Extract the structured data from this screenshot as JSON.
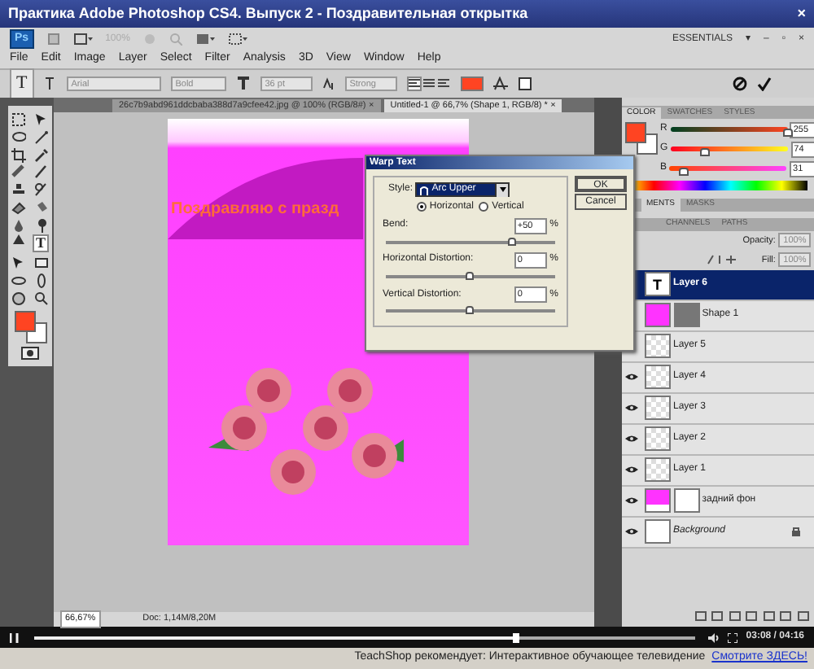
{
  "window": {
    "title": "Практика Adobe Photoshop CS4. Выпуск 2 - Поздравительная открытка",
    "close": "×"
  },
  "app_bar": {
    "logo": "Ps",
    "zoom": "100%",
    "workspace": "ESSENTIALS",
    "workspace_caret": "▾",
    "controls": [
      "–",
      "▫",
      "×"
    ]
  },
  "menu": [
    "File",
    "Edit",
    "Image",
    "Layer",
    "Select",
    "Filter",
    "Analysis",
    "3D",
    "View",
    "Window",
    "Help"
  ],
  "options_bar": {
    "tool": "T",
    "font_family": "Arial",
    "font_style": "Bold",
    "font_size": "36 pt",
    "antialias": "Strong",
    "alignment": [
      {
        "selected": true
      },
      {
        "selected": false
      },
      {
        "selected": false
      }
    ]
  },
  "documents": [
    {
      "title": "26c7b9abd961ddcbaba388d7a9cfee42.jpg @ 100% (RGB/8#)",
      "close": "×",
      "selected": false
    },
    {
      "title": "Untitled-1 @ 66,7% (Shape 1, RGB/8) *",
      "close": "×",
      "selected": true
    }
  ],
  "toolbox": {
    "type_tool": "T"
  },
  "canvas": {
    "text": "Поздравляю с празд"
  },
  "status_bar": {
    "zoom": "66,67%",
    "doc": "Doc: 1,14M/8,20M"
  },
  "color_panel": {
    "tabs": [
      {
        "label": "COLOR",
        "selected": true
      },
      {
        "label": "SWATCHES",
        "selected": false
      },
      {
        "label": "STYLES",
        "selected": false
      }
    ],
    "channels": [
      {
        "name": "R",
        "value": "255",
        "level": 1.0
      },
      {
        "name": "G",
        "value": "74",
        "level": 0.29
      },
      {
        "name": "B",
        "value": "31",
        "level": 0.12
      }
    ]
  },
  "adjustments_tabs": [
    {
      "label": "MENTS",
      "selected": true
    },
    {
      "label": "MASKS",
      "selected": false
    }
  ],
  "layers_tabs": [
    {
      "label": "CHANNELS",
      "selected": false
    },
    {
      "label": "PATHS",
      "selected": false
    }
  ],
  "layers_panel": {
    "opacity_label": "Opacity:",
    "opacity": "100%",
    "fill_label": "Fill:",
    "fill": "100%",
    "layers": [
      {
        "name": "Layer 6",
        "kind": "text",
        "thumb_text": "T",
        "visible": false,
        "selected": true
      },
      {
        "name": "Shape 1",
        "kind": "shape",
        "visible": false,
        "selected": false
      },
      {
        "name": "Layer 5",
        "kind": "raster",
        "visible": false,
        "selected": false
      },
      {
        "name": "Layer 4",
        "kind": "raster",
        "visible": true,
        "selected": false
      },
      {
        "name": "Layer 3",
        "kind": "raster",
        "visible": true,
        "selected": false
      },
      {
        "name": "Layer 2",
        "kind": "raster",
        "visible": true,
        "selected": false
      },
      {
        "name": "Layer 1",
        "kind": "raster",
        "visible": true,
        "selected": false
      },
      {
        "name": "задний фон",
        "kind": "fill",
        "visible": true,
        "selected": false
      },
      {
        "name": "Background",
        "kind": "background",
        "visible": true,
        "selected": false
      }
    ]
  },
  "dialog": {
    "title": "Warp Text",
    "style_label": "Style:",
    "style_value": "Arc Upper",
    "orientation": [
      {
        "label": "Horizontal",
        "selected": true
      },
      {
        "label": "Vertical",
        "selected": false
      }
    ],
    "params": [
      {
        "label": "Bend:",
        "value": "+50",
        "unit": "%",
        "level": 0.75
      },
      {
        "label": "Horizontal Distortion:",
        "value": "0",
        "unit": "%",
        "level": 0.5
      },
      {
        "label": "Vertical Distortion:",
        "value": "0",
        "unit": "%",
        "level": 0.5
      }
    ],
    "buttons": [
      "OK",
      "Cancel"
    ]
  },
  "player": {
    "level": 0.73,
    "time": "03:08 / 04:16"
  },
  "footer": {
    "text": "TeachShop рекомендует: Интерактивное обучающее телевидение",
    "link": "Смотрите ЗДЕСЬ!"
  }
}
